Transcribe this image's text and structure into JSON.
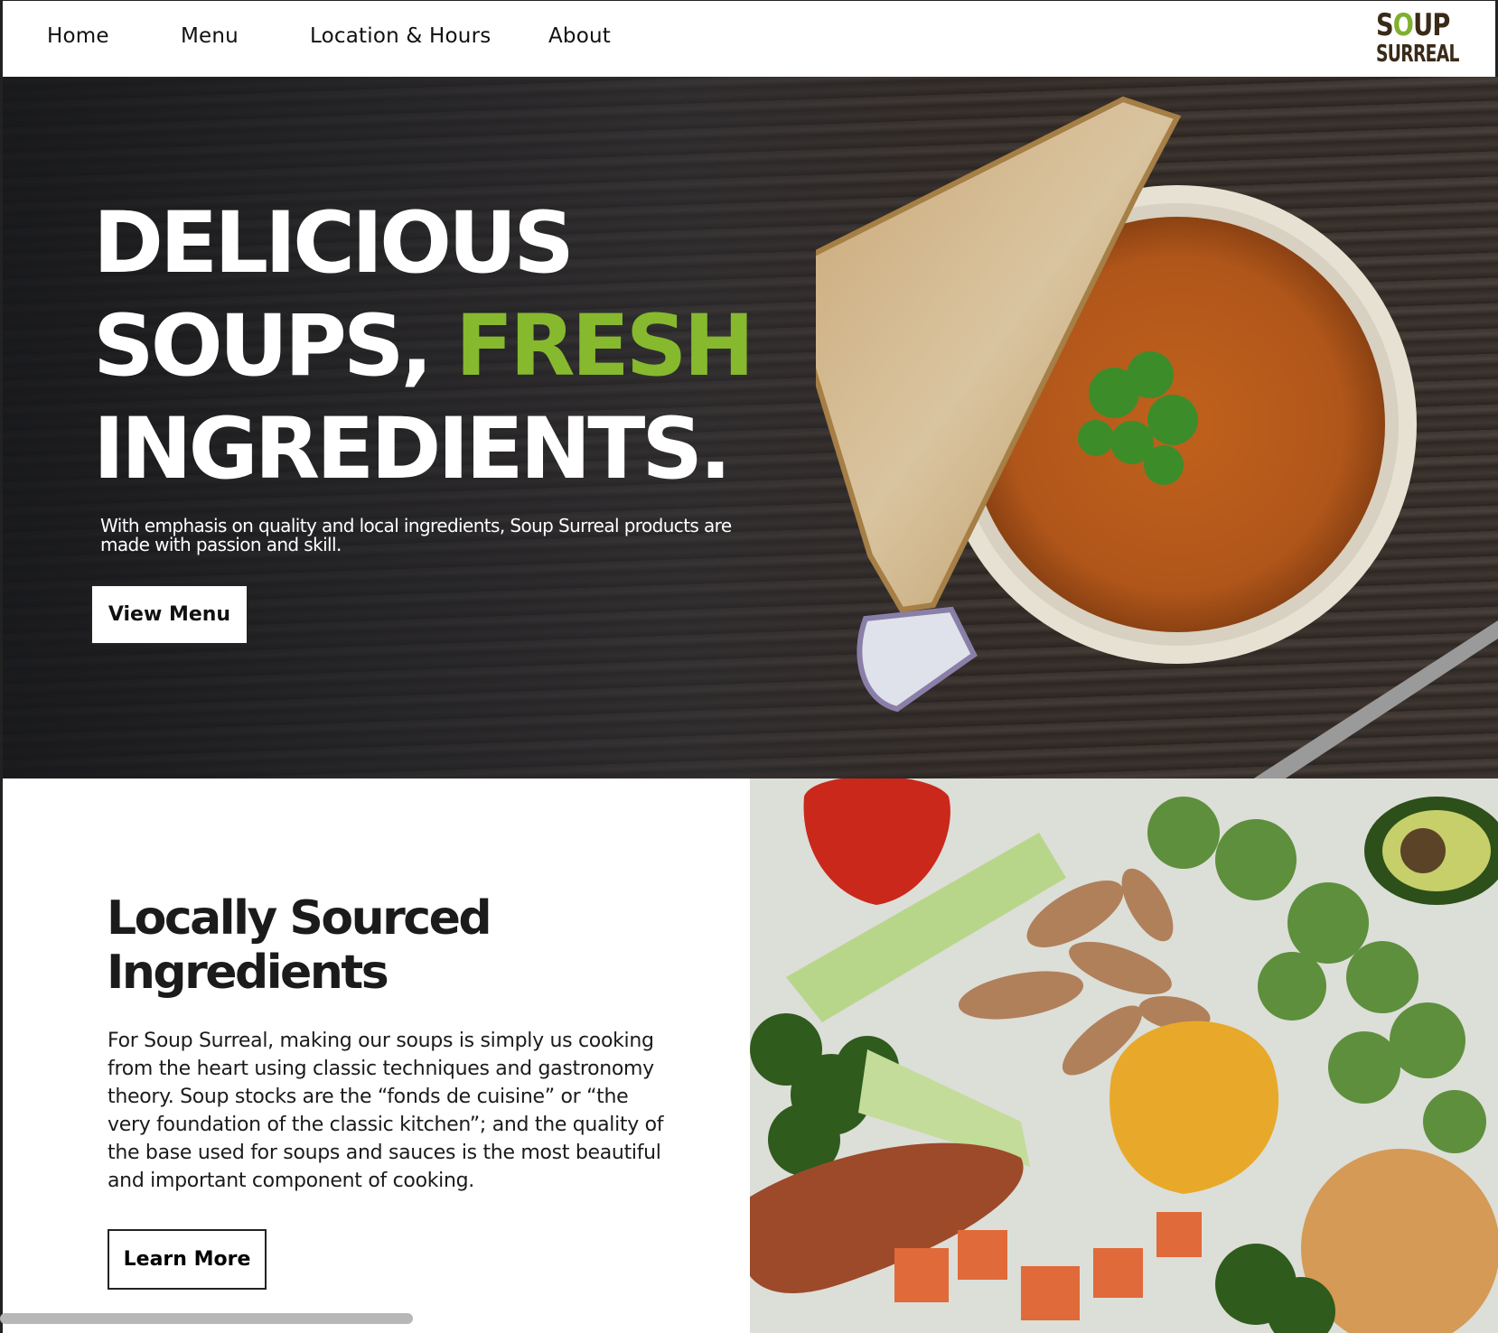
{
  "nav": {
    "items": [
      "Home",
      "Menu",
      "Location & Hours",
      "About"
    ]
  },
  "logo": {
    "line1_s": "S",
    "line1_o": "O",
    "line1_rest": "UP",
    "line2": "SURREAL",
    "colors": {
      "brown": "#3a2a18",
      "green": "#7fb02e"
    }
  },
  "hero": {
    "title_line1": "DELICIOUS",
    "title_line2_a": "SOUPS,",
    "title_line2_b": "FRESH",
    "title_line3": "INGREDIENTS.",
    "subtitle": "With emphasis on quality and local ingredients, Soup Surreal products are made with passion and skill.",
    "button": "View  Menu",
    "accent_color": "#86b92e"
  },
  "section": {
    "title": "Locally Sourced Ingredients",
    "body": "For Soup Surreal, making our soups is simply us cooking from the heart using classic techniques and gastronomy theory. Soup stocks are the “fonds de cuisine” or “the very foundation of the classic kitchen”; and the quality of the base used for soups and sauces is the most beautiful and important component of cooking.",
    "button": "Learn More"
  }
}
